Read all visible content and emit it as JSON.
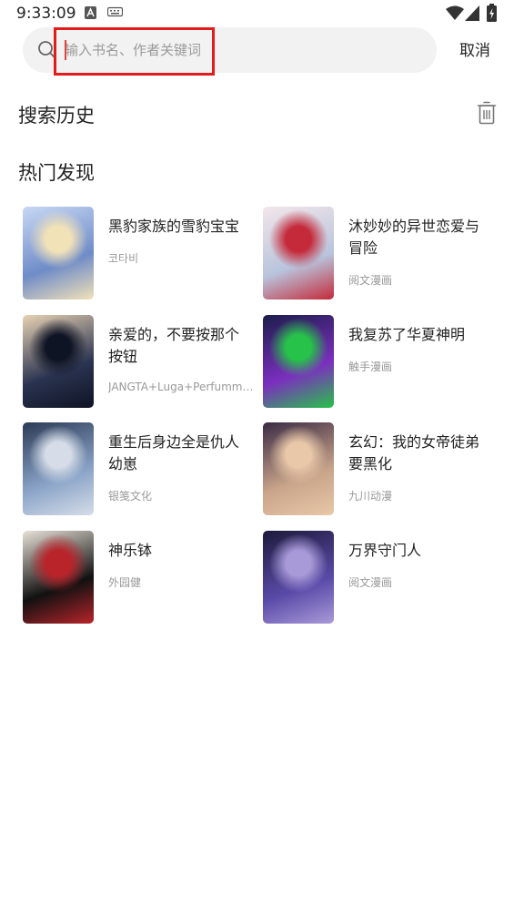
{
  "status_bar": {
    "time": "9:33:09"
  },
  "search": {
    "placeholder": "输入书名、作者关键词",
    "value": "",
    "cancel_label": "取消"
  },
  "history": {
    "title": "搜索历史"
  },
  "discover": {
    "title": "热门发现",
    "books": [
      {
        "title": "黑豹家族的雪豹宝宝",
        "author": "코타비",
        "colors": [
          "#c8d8f4",
          "#6f8cc8",
          "#f2e2b8"
        ]
      },
      {
        "title": "沐妙妙的异世恋爱与冒险",
        "author": "阅文漫画",
        "colors": [
          "#f3e6ea",
          "#b8c4dc",
          "#c42a3a"
        ]
      },
      {
        "title": "亲爱的，不要按那个按钮",
        "author": "JANGTA+Luga+Perfumm ...",
        "colors": [
          "#e8d3b4",
          "#2a3350",
          "#0f1424"
        ]
      },
      {
        "title": "我复苏了华夏神明",
        "author": "触手漫画",
        "colors": [
          "#1b1d4a",
          "#7b2fbf",
          "#27c24a"
        ]
      },
      {
        "title": "重生后身边全是仇人幼崽",
        "author": "银笺文化",
        "colors": [
          "#2b3a55",
          "#8aa4c8",
          "#d6dde8"
        ]
      },
      {
        "title": "玄幻：我的女帝徒弟要黑化",
        "author": "九川动漫",
        "colors": [
          "#3a2a44",
          "#c9a48a",
          "#e8c8a8"
        ]
      },
      {
        "title": "神乐钵",
        "author": "外园健",
        "colors": [
          "#e8e2d8",
          "#111111",
          "#b8242a"
        ]
      },
      {
        "title": "万界守门人",
        "author": "阅文漫画",
        "colors": [
          "#1d1a3a",
          "#5a4aa8",
          "#a89ad8"
        ]
      }
    ]
  }
}
